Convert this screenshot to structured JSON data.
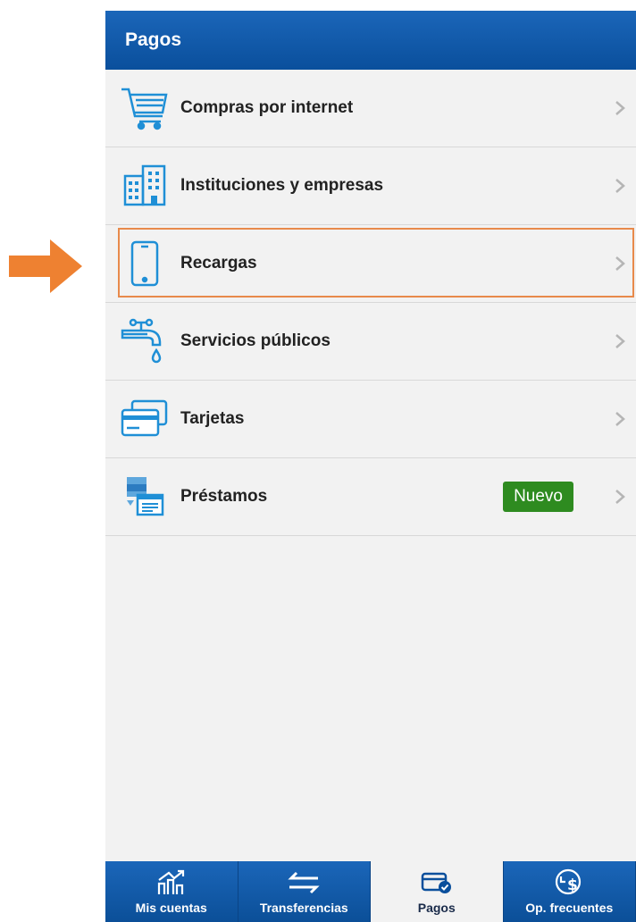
{
  "header": {
    "title": "Pagos"
  },
  "menu": {
    "items": [
      {
        "label": "Compras por internet",
        "icon": "cart-icon"
      },
      {
        "label": "Instituciones y empresas",
        "icon": "buildings-icon"
      },
      {
        "label": "Recargas",
        "icon": "mobile-phone-icon"
      },
      {
        "label": "Servicios públicos",
        "icon": "water-faucet-icon"
      },
      {
        "label": "Tarjetas",
        "icon": "credit-cards-icon"
      },
      {
        "label": "Préstamos",
        "icon": "loan-money-icon",
        "badge": "Nuevo"
      }
    ]
  },
  "tabbar": {
    "tabs": [
      {
        "label": "Mis cuentas",
        "icon": "chart-growth-icon"
      },
      {
        "label": "Transferencias",
        "icon": "transfer-arrows-icon"
      },
      {
        "label": "Pagos",
        "icon": "card-check-icon",
        "active": true
      },
      {
        "label": "Op. frecuentes",
        "icon": "clock-dollar-icon"
      }
    ]
  },
  "colors": {
    "primary_blue": "#0a4f9c",
    "icon_blue": "#1f8fd6",
    "badge_green": "#2e8b20",
    "highlight_orange": "#e88a4b",
    "arrow_orange": "#ee8131"
  }
}
